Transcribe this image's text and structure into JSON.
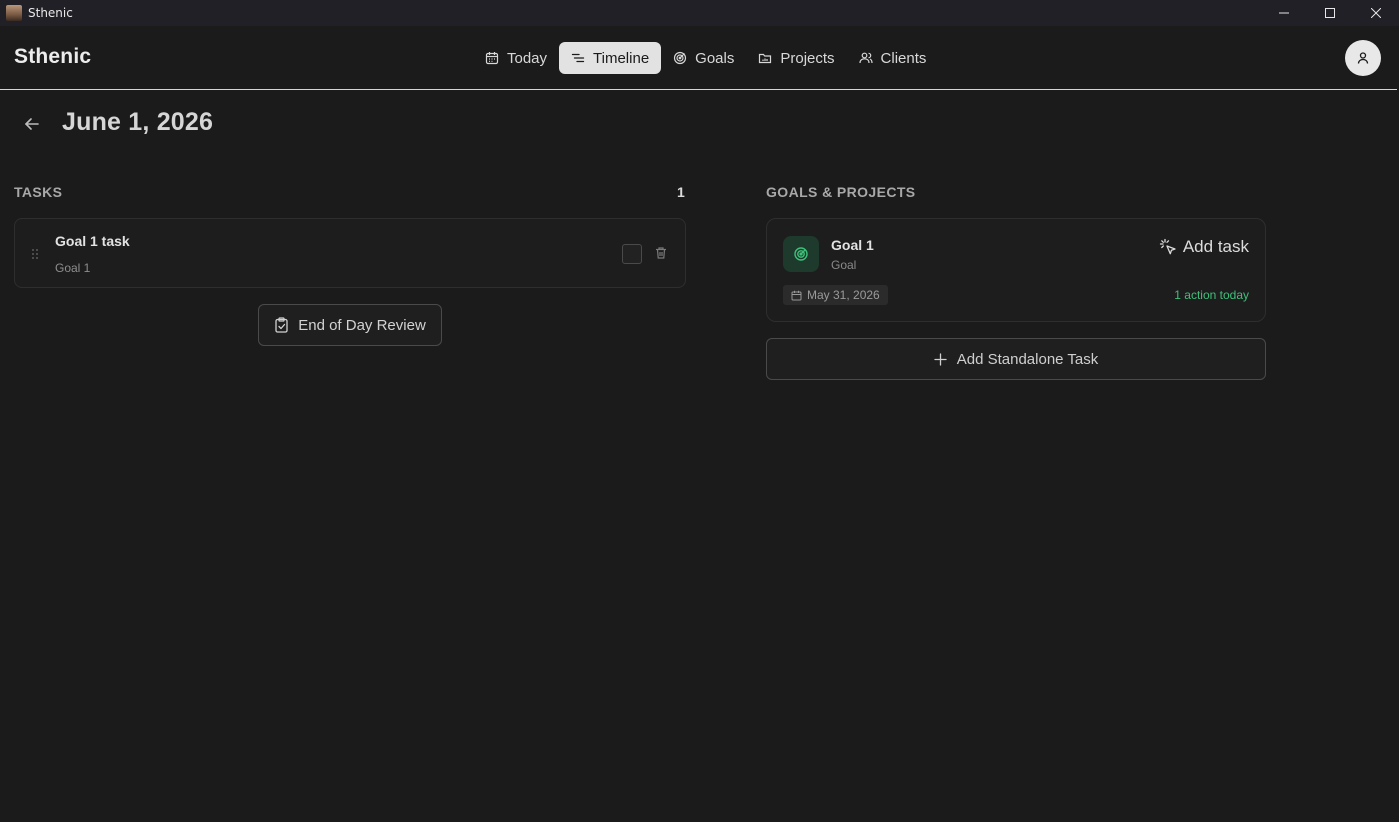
{
  "window": {
    "title": "Sthenic",
    "controls": [
      "minimize-icon",
      "maximize-icon",
      "close-icon"
    ]
  },
  "header": {
    "brand": "Sthenic",
    "nav": [
      {
        "label": "Today",
        "icon": "calendar-icon",
        "active": false
      },
      {
        "label": "Timeline",
        "icon": "timeline-icon",
        "active": true
      },
      {
        "label": "Goals",
        "icon": "target-icon",
        "active": false
      },
      {
        "label": "Projects",
        "icon": "folder-icon",
        "active": false
      },
      {
        "label": "Clients",
        "icon": "users-icon",
        "active": false
      }
    ],
    "avatar_icon": "user-icon"
  },
  "page": {
    "title": "June 1, 2026",
    "back_icon": "arrow-left-icon"
  },
  "tasks": {
    "label": "TASKS",
    "count": "1",
    "items": [
      {
        "title": "Goal 1 task",
        "subtitle": "Goal 1",
        "completed": false
      }
    ],
    "review_button": "End of Day Review"
  },
  "goals_projects": {
    "label": "GOALS & PROJECTS",
    "cards": [
      {
        "title": "Goal 1",
        "type": "Goal",
        "add_task_label": "Add task",
        "date": "May 31, 2026",
        "status": "1 action today"
      }
    ],
    "standalone_button": "Add Standalone Task"
  },
  "colors": {
    "background": "#1b1b1b",
    "active_nav_bg": "#e2e2e2",
    "accent_green": "#3ec07a",
    "goal_icon_bg": "#1e3a2c"
  }
}
